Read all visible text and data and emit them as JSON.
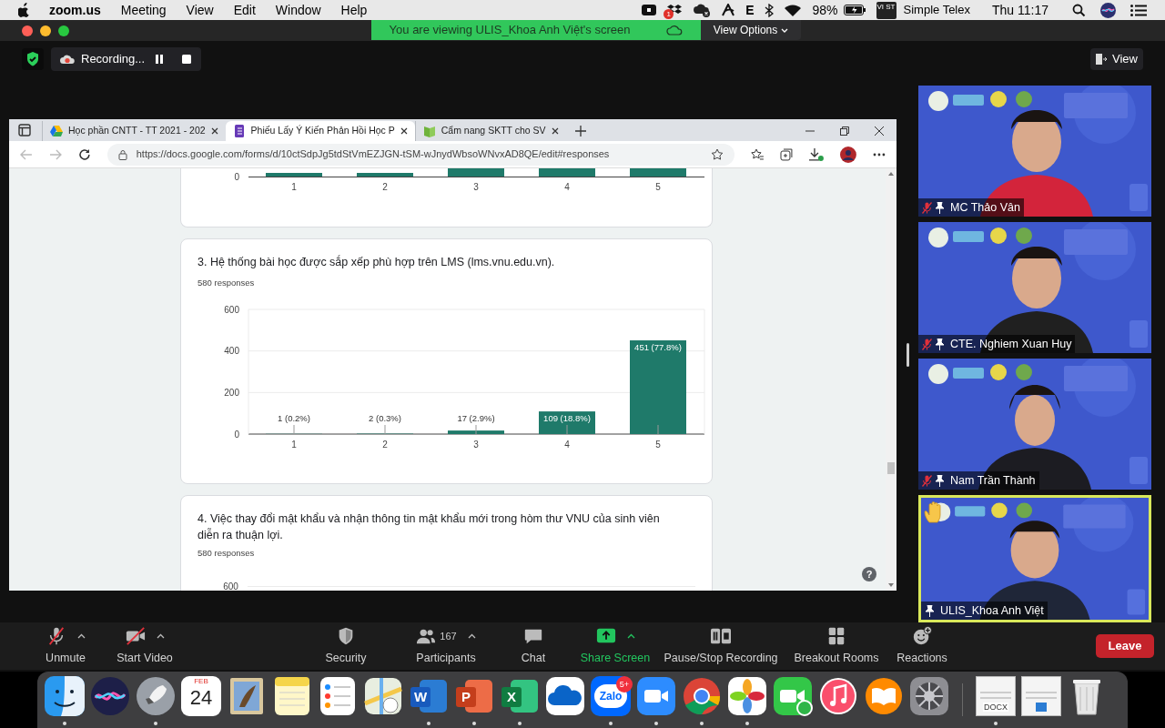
{
  "menu_bar": {
    "app": "zoom.us",
    "menus": [
      "Meeting",
      "View",
      "Edit",
      "Window",
      "Help"
    ],
    "notification_badge": "1",
    "keyboard_letter": "E",
    "battery": "98%",
    "input_source_badge": "VI ST",
    "input_source": "Simple Telex",
    "clock": "Thu 11:17"
  },
  "window": {
    "banner": "You are viewing ULIS_Khoa Anh Việt's screen",
    "view_options": "View Options",
    "recording": "Recording...",
    "view": "View"
  },
  "browser": {
    "tabs": [
      {
        "kind": "drive",
        "label": "Học phần CNTT - TT 2021 - 202",
        "selected": false
      },
      {
        "kind": "forms",
        "label": "Phiếu Lấy Ý Kiến Phản Hồi Học P",
        "selected": true
      },
      {
        "kind": "book",
        "label": "Cẩm nang SKTT cho SV",
        "selected": false
      }
    ],
    "url": "https://docs.google.com/forms/d/10ctSdpJg5tdStVmEZJGN-tSM-wJnydWbsoWNvxAD8QE/edit#responses"
  },
  "forms": {
    "partial_chart": {
      "y_tick": "0",
      "x_labels": [
        "1",
        "2",
        "3",
        "4",
        "5"
      ]
    },
    "questions": [
      {
        "kind": "chart",
        "title": "3. Hệ thống bài học được sắp xếp phù hợp trên LMS (lms.vnu.edu.vn).",
        "responses": "580 responses",
        "chart_data": {
          "type": "bar",
          "categories": [
            "1",
            "2",
            "3",
            "4",
            "5"
          ],
          "values": [
            1,
            2,
            17,
            109,
            451
          ],
          "ylim": [
            0,
            600
          ],
          "yticks": [
            0,
            200,
            400,
            600
          ],
          "value_labels": [
            "1 (0.2%)",
            "2 (0.3%)",
            "17 (2.9%)",
            "109 (18.8%)",
            "451 (77.8%)"
          ]
        }
      },
      {
        "kind": "partial",
        "title": "4. Việc thay đổi mật khẩu và nhận thông tin mật khẩu mới trong hòm thư VNU của sinh viên diễn ra thuận lợi.",
        "responses": "580 responses",
        "y_tick": "600"
      }
    ],
    "help": "?"
  },
  "participants": [
    {
      "name": "MC Thảo Vân",
      "muted": true,
      "hand_raised": false,
      "speaking": false
    },
    {
      "name": "CTE. Nghiem Xuan Huy",
      "muted": true,
      "hand_raised": false,
      "speaking": false
    },
    {
      "name": "Nam Trần Thành",
      "muted": true,
      "hand_raised": false,
      "speaking": false
    },
    {
      "name": "ULIS_Khoa Anh Việt",
      "muted": false,
      "hand_raised": true,
      "speaking": true
    }
  ],
  "toolbar": {
    "items": [
      {
        "kind": "mic",
        "label": "Unmute",
        "caret": true
      },
      {
        "kind": "video",
        "label": "Start Video",
        "caret": true
      },
      {
        "kind": "security",
        "label": "Security",
        "caret": false
      },
      {
        "kind": "participants",
        "label": "Participants",
        "count": "167",
        "caret": true
      },
      {
        "kind": "chat",
        "label": "Chat",
        "caret": false
      },
      {
        "kind": "share",
        "label": "Share Screen",
        "caret": true
      },
      {
        "kind": "record",
        "label": "Pause/Stop Recording",
        "caret": false
      },
      {
        "kind": "breakout",
        "label": "Breakout Rooms",
        "caret": false
      },
      {
        "kind": "reactions",
        "label": "Reactions",
        "caret": false
      }
    ],
    "leave": "Leave"
  },
  "dock": [
    {
      "kind": "finder",
      "running": true
    },
    {
      "kind": "siri",
      "running": false
    },
    {
      "kind": "launchpad",
      "running": true
    },
    {
      "kind": "calendar",
      "running": false,
      "month": "FEB",
      "day": "24"
    },
    {
      "kind": "bird",
      "running": false
    },
    {
      "kind": "notes",
      "running": false
    },
    {
      "kind": "reminders",
      "running": false
    },
    {
      "kind": "maps",
      "running": false
    },
    {
      "kind": "word",
      "running": true,
      "letter": "W"
    },
    {
      "kind": "powerpoint",
      "running": true,
      "letter": "P"
    },
    {
      "kind": "excel",
      "running": true,
      "letter": "X"
    },
    {
      "kind": "onedrive",
      "running": false
    },
    {
      "kind": "zalo",
      "running": true,
      "letter": "Zalo",
      "badge": "5+"
    },
    {
      "kind": "zoom",
      "running": true
    },
    {
      "kind": "chrome",
      "running": true
    },
    {
      "kind": "photos",
      "running": true
    },
    {
      "kind": "facetime",
      "running": false
    },
    {
      "kind": "music",
      "running": false
    },
    {
      "kind": "books",
      "running": false
    },
    {
      "kind": "settings",
      "running": false
    },
    {
      "kind": "separator"
    },
    {
      "kind": "document",
      "running": true,
      "letter": "DOCX"
    },
    {
      "kind": "document",
      "running": false
    },
    {
      "kind": "trash",
      "running": false
    }
  ]
}
